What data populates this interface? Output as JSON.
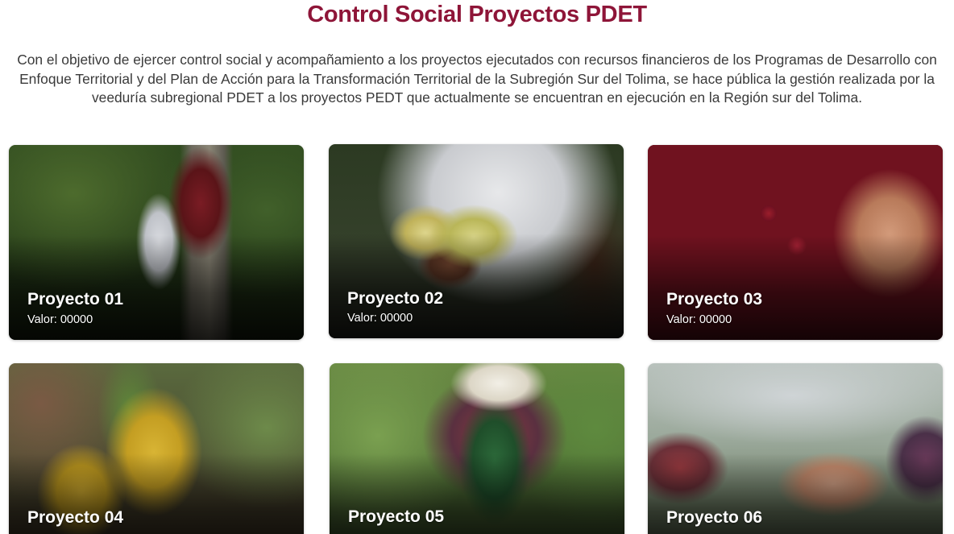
{
  "header": {
    "title": "Control Social Proyectos PDET",
    "intro": "Con el objetivo de ejercer control social y acompañamiento a los proyectos ejecutados con recursos financieros de   los Programas de Desarrollo con Enfoque Territorial y del Plan de Acción para la Transformación Territorial de la Subregión Sur del Tolima, se hace pública la gestión realizada por la veeduría subregional PDET a los proyectos PEDT que actualmente se encuentran en ejecución en la Región sur del Tolima."
  },
  "colors": {
    "title": "#8e1538",
    "body_text": "#3a3a3a",
    "card_text": "#ffffff"
  },
  "projects": [
    {
      "name": "Proyecto 01",
      "value": "Valor: 00000"
    },
    {
      "name": "Proyecto 02",
      "value": "Valor: 00000"
    },
    {
      "name": "Proyecto 03",
      "value": "Valor: 00000"
    },
    {
      "name": "Proyecto 04"
    },
    {
      "name": "Proyecto 05"
    },
    {
      "name": "Proyecto 06"
    }
  ]
}
